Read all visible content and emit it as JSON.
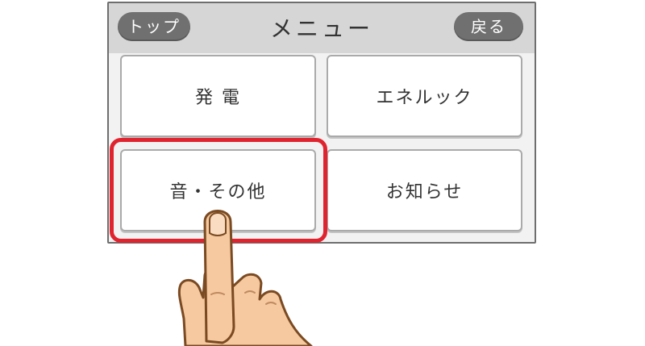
{
  "header": {
    "title": "メニュー",
    "top_button": "トップ",
    "back_button": "戻る"
  },
  "menu": {
    "items": [
      {
        "label": "発 電"
      },
      {
        "label": "エネルック"
      },
      {
        "label": "音・その他"
      },
      {
        "label": "お知らせ"
      }
    ]
  },
  "colors": {
    "highlight": "#e0242f",
    "header_bg": "#d6d6d6",
    "pill_bg": "#707070",
    "skin": "#f6c9a0",
    "outline": "#7a4a22"
  },
  "icons": {
    "pointer": "finger-pointer-icon"
  }
}
